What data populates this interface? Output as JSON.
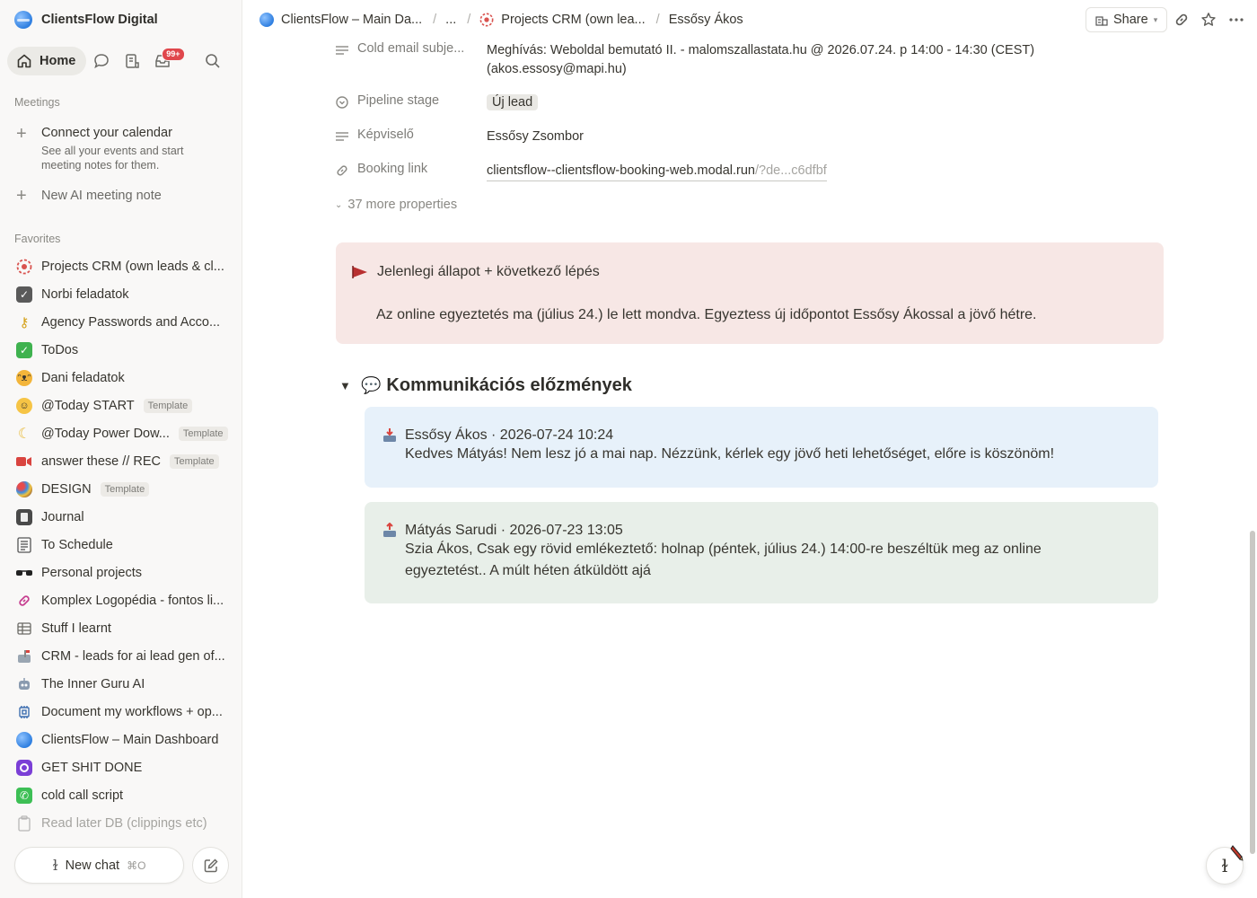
{
  "sidebar": {
    "workspace_name": "ClientsFlow Digital",
    "home_label": "Home",
    "inbox_badge": "99+",
    "meetings_label": "Meetings",
    "connect_calendar_title": "Connect your calendar",
    "connect_calendar_desc": "See all your events and start meeting notes for them.",
    "new_ai_meeting_note": "New AI meeting note",
    "favorites_label": "Favorites",
    "favorites": [
      {
        "label": "Projects CRM (own leads & cl...",
        "icon": "target-icon"
      },
      {
        "label": "Norbi feladatok",
        "icon": "checkbox-icon"
      },
      {
        "label": "Agency Passwords and Acco...",
        "icon": "key-icon"
      },
      {
        "label": "ToDos",
        "icon": "green-check-icon"
      },
      {
        "label": "Dani feladatok",
        "icon": "cat-icon"
      },
      {
        "label": "@Today START",
        "icon": "smile-icon",
        "template": "Template"
      },
      {
        "label": "@Today Power Dow...",
        "icon": "moon-icon",
        "template": "Template"
      },
      {
        "label": "answer these // REC",
        "icon": "video-camera-icon",
        "template": "Template"
      },
      {
        "label": "DESIGN",
        "icon": "palette-icon",
        "template": "Template"
      },
      {
        "label": "Journal",
        "icon": "notebook-icon"
      },
      {
        "label": "To Schedule",
        "icon": "list-icon"
      },
      {
        "label": "Personal projects",
        "icon": "sunglasses-icon"
      },
      {
        "label": "Komplex Logopédia - fontos li...",
        "icon": "link-icon"
      },
      {
        "label": "Stuff I learnt",
        "icon": "table-icon"
      },
      {
        "label": "CRM - leads for ai lead gen of...",
        "icon": "mailbox-icon"
      },
      {
        "label": "The Inner Guru AI",
        "icon": "robot-icon"
      },
      {
        "label": "Document my workflows + op...",
        "icon": "chip-icon"
      },
      {
        "label": "ClientsFlow – Main Dashboard",
        "icon": "globe-icon"
      },
      {
        "label": "GET SHIT DONE",
        "icon": "purple-eye-icon"
      },
      {
        "label": "cold call script",
        "icon": "phone-icon"
      },
      {
        "label": "Read later DB (clippings etc)",
        "icon": "clipboard-icon"
      }
    ],
    "new_chat_label": "New chat",
    "new_chat_shortcut": "⌘O"
  },
  "topbar": {
    "crumb1": "ClientsFlow – Main Da...",
    "crumb_ellipsis": "...",
    "crumb2": "Projects CRM (own lea...",
    "crumb3": "Essősy Ákos",
    "share_label": "Share"
  },
  "properties": [
    {
      "name": "Cold email subje...",
      "value": "Meghívás: Weboldal bemutató II.  - malomszallastata.hu @ 2026.07.24. p 14:00 - 14:30 (CEST)",
      "value2": "(akos.essosy@mapi.hu)"
    },
    {
      "name": "Pipeline stage",
      "value": "Új lead"
    },
    {
      "name": "Képviselő",
      "value": "Essősy Zsombor"
    },
    {
      "name": "Booking link",
      "value": "clientsflow--clientsflow-booking-web.modal.run",
      "value_faded": "/?de...c6dfbf"
    }
  ],
  "more_properties": "37 more properties",
  "callout": {
    "title": "Jelenlegi állapot + következő lépés",
    "body": "Az online egyeztetés ma (július 24.) le lett mondva. Egyeztess új időpontot Essősy Ákossal a jövő hétre."
  },
  "toggle_heading": "Kommunikációs előzmények",
  "messages": [
    {
      "header": "Essősy Ákos · 2026-07-24 10:24",
      "body": "Kedves Mátyás! Nem lesz jó a mai nap. Nézzünk, kérlek egy jövő heti lehetőséget, előre is köszönöm!",
      "color": "#e7f1fa"
    },
    {
      "header": "Mátyás Sarudi · 2026-07-23 13:05",
      "body": "Szia Ákos, Csak egy rövid emlékeztető: holnap (péntek, július 24.) 14:00-re beszéltük meg az online egyeztetést.. A múlt héten átküldött ajá",
      "color": "#e8efe9"
    }
  ],
  "colors": {
    "callout_bg": "#f7e7e5",
    "badge": "#e0474c",
    "accent_blue": "#2f7fe0"
  }
}
